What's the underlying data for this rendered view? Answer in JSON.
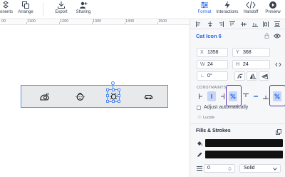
{
  "toolbar": {
    "left_items": [
      {
        "label": "onents",
        "icon": "components-icon"
      },
      {
        "label": "Arrange",
        "icon": "arrange-icon"
      },
      {
        "label": "Export",
        "icon": "export-icon"
      },
      {
        "label": "Sharing",
        "icon": "sharing-icon"
      }
    ],
    "right_items": [
      {
        "label": "Format",
        "icon": "format-icon",
        "active": true
      },
      {
        "label": "Interactions",
        "icon": "interactions-icon"
      },
      {
        "label": "Handoff",
        "icon": "handoff-icon"
      },
      {
        "label": "Preview",
        "icon": "preview-icon"
      }
    ]
  },
  "ruler": {
    "labels": [
      "00",
      "1100",
      "1200",
      "1300",
      "1400",
      "1500"
    ]
  },
  "canvas": {
    "icons": [
      "snail-icon",
      "baby-icon",
      "bug-icon",
      "car-icon"
    ],
    "selected_icon": "bug-icon"
  },
  "inspector": {
    "layer_name": "Cat Icon 6",
    "x": {
      "prefix": "X",
      "value": "1356"
    },
    "y": {
      "prefix": "Y",
      "value": "368"
    },
    "w": {
      "prefix": "W",
      "value": "24"
    },
    "h": {
      "prefix": "H",
      "value": "24"
    },
    "rotation": {
      "prefix": "∟",
      "value": "0°"
    },
    "constraints_label": "CONSTRAINTS",
    "adjust_label": "Adjust automatically",
    "source_tag": "Lucide",
    "fills_title": "Fills & Strokes",
    "stroke_width": "0",
    "stroke_style": "Solid"
  },
  "colors": {
    "accent": "#2563eb",
    "highlight": "#5b2fb3",
    "fill": "#111111"
  }
}
